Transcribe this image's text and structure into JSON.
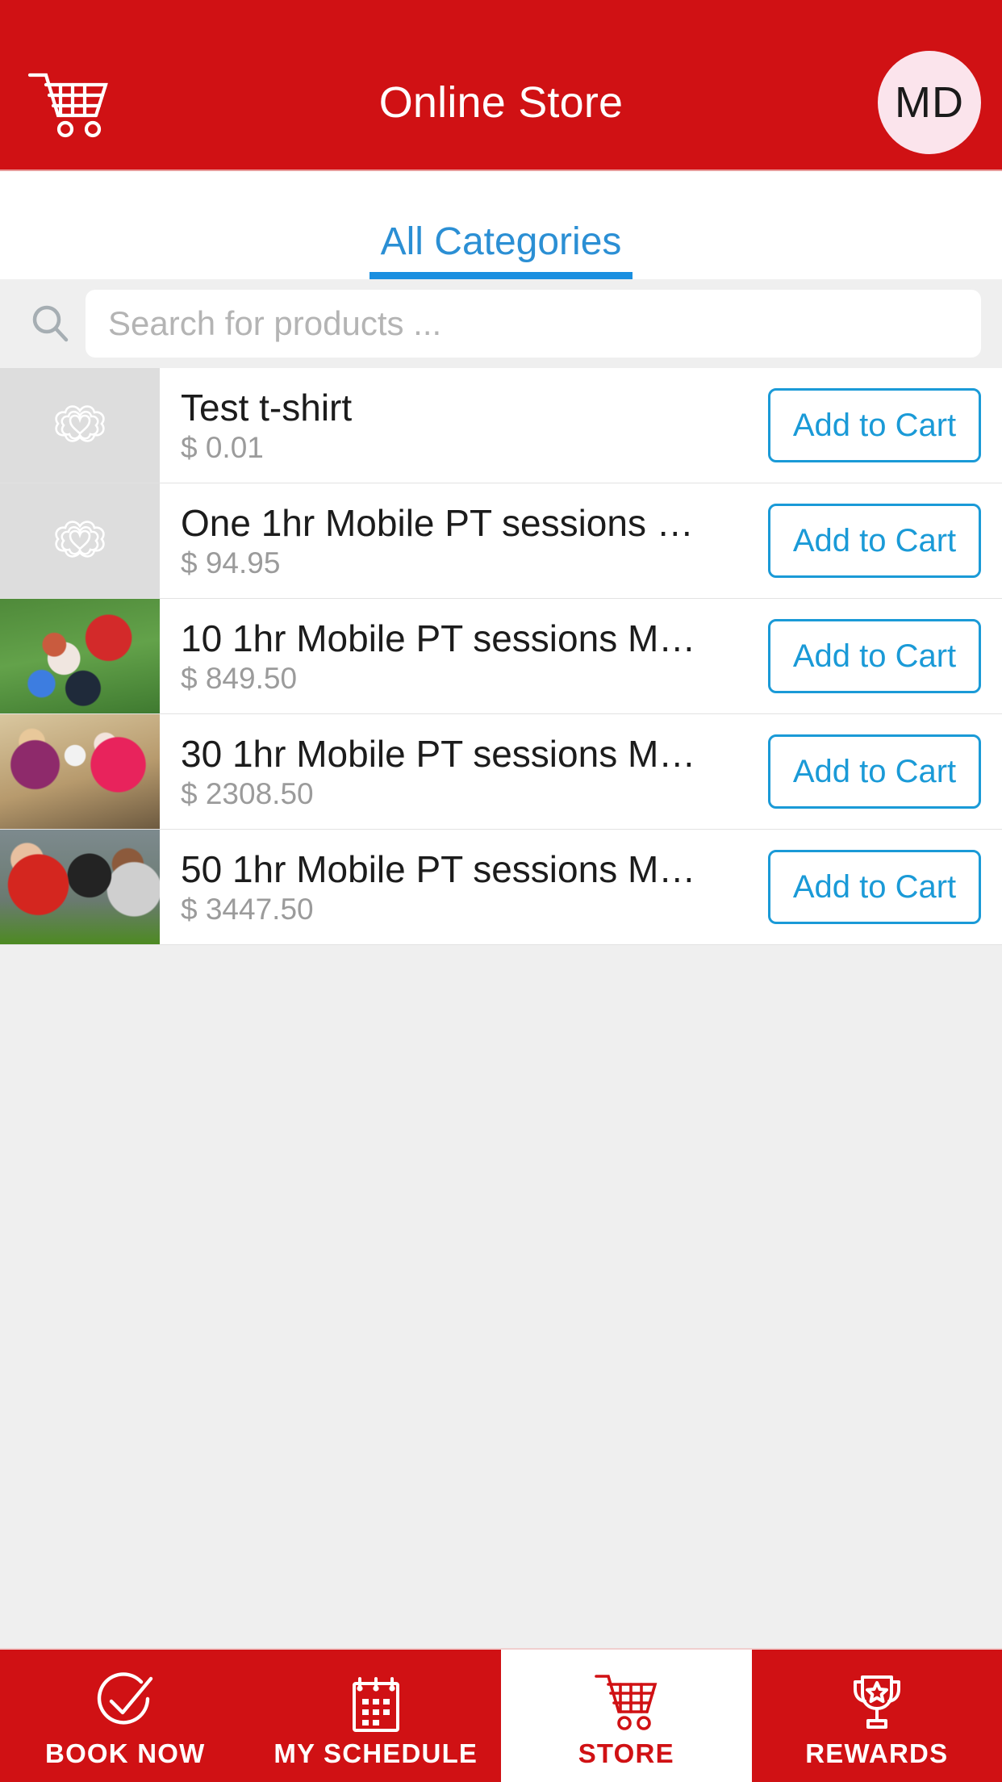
{
  "header": {
    "title": "Online Store",
    "cart_icon": "shopping-cart-icon",
    "avatar_initials": "MD"
  },
  "category_tabs": [
    {
      "label": "All Categories",
      "active": true
    }
  ],
  "search": {
    "icon": "search-icon",
    "placeholder": "Search for products ...",
    "value": ""
  },
  "products": [
    {
      "name": "Test t-shirt",
      "price": "$ 0.01",
      "thumb": "placeholder",
      "button": "Add to Cart"
    },
    {
      "name": "One 1hr Mobile PT sessions …",
      "price": "$ 94.95",
      "thumb": "placeholder",
      "button": "Add to Cart"
    },
    {
      "name": "10 1hr Mobile PT sessions M…",
      "price": "$ 849.50",
      "thumb": "photo-1",
      "button": "Add to Cart"
    },
    {
      "name": "30 1hr Mobile PT sessions M…",
      "price": "$ 2308.50",
      "thumb": "photo-2",
      "button": "Add to Cart"
    },
    {
      "name": "50 1hr Mobile PT sessions M…",
      "price": "$ 3447.50",
      "thumb": "photo-3",
      "button": "Add to Cart"
    }
  ],
  "bottom_nav": [
    {
      "label": "BOOK NOW",
      "icon": "check-circle-icon",
      "active": false
    },
    {
      "label": "MY SCHEDULE",
      "icon": "calendar-icon",
      "active": false
    },
    {
      "label": "STORE",
      "icon": "shopping-cart-icon",
      "active": true
    },
    {
      "label": "REWARDS",
      "icon": "trophy-icon",
      "active": false
    }
  ],
  "colors": {
    "brand_red": "#d01114",
    "accent_blue": "#1a9ad7",
    "tab_blue": "#2b8fd4",
    "page_bg": "#efefef",
    "avatar_bg": "#fbe4ec"
  }
}
